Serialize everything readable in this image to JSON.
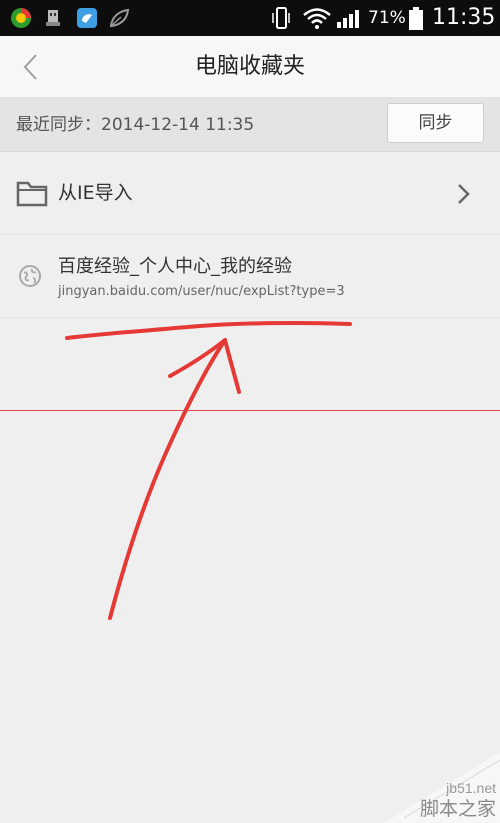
{
  "status_bar": {
    "battery_percent": "71%",
    "time": "11:35",
    "icons": [
      "app-360-icon",
      "usb-icon",
      "ie-browser-icon",
      "leaf-icon",
      "vibrate-icon",
      "wifi-icon",
      "signal-icon",
      "battery-icon"
    ]
  },
  "header": {
    "title": "电脑收藏夹",
    "back_icon": "chevron-left-icon"
  },
  "sync": {
    "last_sync_text": "最近同步：2014-12-14 11:35",
    "button_label": "同步"
  },
  "list": {
    "import_label": "从IE导入",
    "import_icon": "folder-icon",
    "bookmarks": [
      {
        "title": "百度经验_个人中心_我的经验",
        "url": "jingyan.baidu.com/user/nuc/expList?type=3",
        "icon": "globe-icon"
      }
    ]
  },
  "annotation": {
    "color": "#e53935"
  },
  "watermark": {
    "domain": "jb51.net",
    "name": "脚本之家"
  }
}
